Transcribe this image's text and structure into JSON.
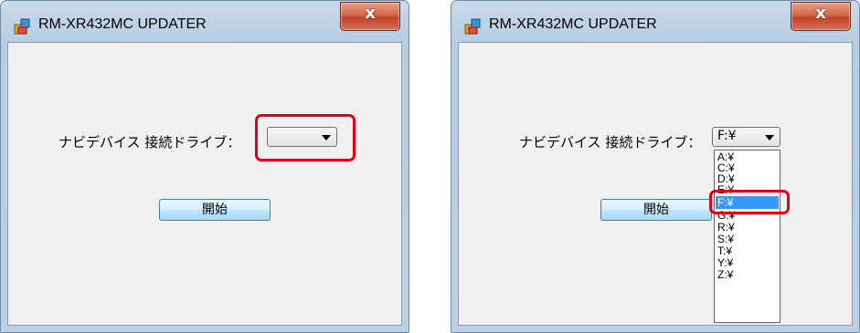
{
  "windows": [
    {
      "title": "RM-XR432MC UPDATER",
      "close_glyph": "x",
      "drive_label": "ナビデバイス 接続ドライブ：",
      "combo_value": "",
      "start_label": "開始"
    },
    {
      "title": "RM-XR432MC UPDATER",
      "close_glyph": "x",
      "drive_label": "ナビデバイス 接続ドライブ：",
      "combo_value": "F:¥",
      "start_label": "開始",
      "dropdown_options": [
        "A:¥",
        "C:¥",
        "D:¥",
        "E:¥",
        "F:¥",
        "G:¥",
        "R:¥",
        "S:¥",
        "T:¥",
        "Y:¥",
        "Z:¥"
      ],
      "selected_option": "F:¥"
    }
  ],
  "colors": {
    "highlight": "#e0001a",
    "selection": "#3399ff",
    "close_button": "#c2432a"
  },
  "icons": [
    "app-icon",
    "close-icon",
    "dropdown-arrow-icon"
  ]
}
